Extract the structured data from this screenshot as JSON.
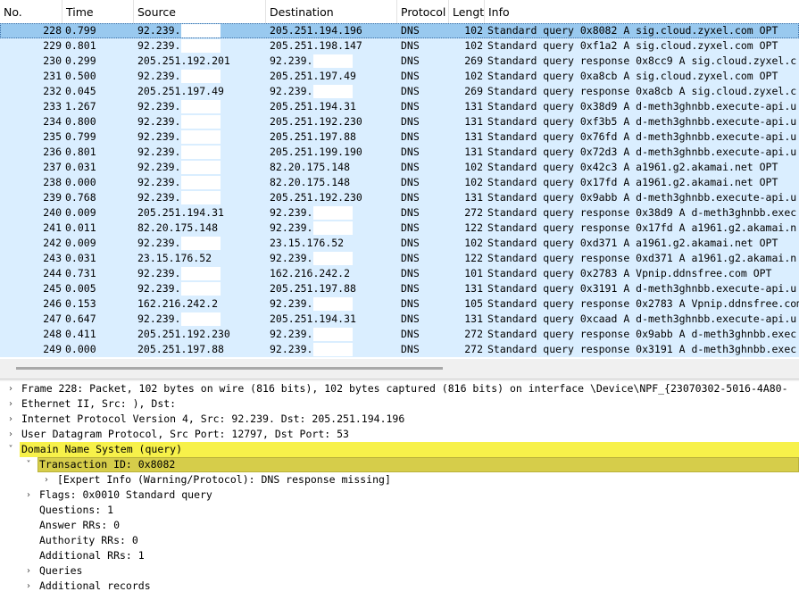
{
  "columns": [
    "No.",
    "Time",
    "Source",
    "Destination",
    "Protocol",
    "Length",
    "Info"
  ],
  "packets": [
    {
      "no": "228",
      "time": "0.799",
      "src": "92.239.",
      "dst": "205.251.194.196",
      "proto": "DNS",
      "len": "102",
      "info": "Standard query 0x8082 A sig.cloud.zyxel.com OPT"
    },
    {
      "no": "229",
      "time": "0.801",
      "src": "92.239.",
      "dst": "205.251.198.147",
      "proto": "DNS",
      "len": "102",
      "info": "Standard query 0xf1a2 A sig.cloud.zyxel.com OPT"
    },
    {
      "no": "230",
      "time": "0.299",
      "src": "205.251.192.201",
      "dst": "92.239.",
      "proto": "DNS",
      "len": "269",
      "info": "Standard query response 0x8cc9 A sig.cloud.zyxel.c"
    },
    {
      "no": "231",
      "time": "0.500",
      "src": "92.239.",
      "dst": "205.251.197.49",
      "proto": "DNS",
      "len": "102",
      "info": "Standard query 0xa8cb A sig.cloud.zyxel.com OPT"
    },
    {
      "no": "232",
      "time": "0.045",
      "src": "205.251.197.49",
      "dst": "92.239.",
      "proto": "DNS",
      "len": "269",
      "info": "Standard query response 0xa8cb A sig.cloud.zyxel.c"
    },
    {
      "no": "233",
      "time": "1.267",
      "src": "92.239.",
      "dst": "205.251.194.31",
      "proto": "DNS",
      "len": "131",
      "info": "Standard query 0x38d9 A d-meth3ghnbb.execute-api.u"
    },
    {
      "no": "234",
      "time": "0.800",
      "src": "92.239.",
      "dst": "205.251.192.230",
      "proto": "DNS",
      "len": "131",
      "info": "Standard query 0xf3b5 A d-meth3ghnbb.execute-api.u"
    },
    {
      "no": "235",
      "time": "0.799",
      "src": "92.239.",
      "dst": "205.251.197.88",
      "proto": "DNS",
      "len": "131",
      "info": "Standard query 0x76fd A d-meth3ghnbb.execute-api.u"
    },
    {
      "no": "236",
      "time": "0.801",
      "src": "92.239.",
      "dst": "205.251.199.190",
      "proto": "DNS",
      "len": "131",
      "info": "Standard query 0x72d3 A d-meth3ghnbb.execute-api.u"
    },
    {
      "no": "237",
      "time": "0.031",
      "src": "92.239.",
      "dst": "82.20.175.148",
      "proto": "DNS",
      "len": "102",
      "info": "Standard query 0x42c3 A a1961.g2.akamai.net OPT"
    },
    {
      "no": "238",
      "time": "0.000",
      "src": "92.239.",
      "dst": "82.20.175.148",
      "proto": "DNS",
      "len": "102",
      "info": "Standard query 0x17fd A a1961.g2.akamai.net OPT"
    },
    {
      "no": "239",
      "time": "0.768",
      "src": "92.239.",
      "dst": "205.251.192.230",
      "proto": "DNS",
      "len": "131",
      "info": "Standard query 0x9abb A d-meth3ghnbb.execute-api.u"
    },
    {
      "no": "240",
      "time": "0.009",
      "src": "205.251.194.31",
      "dst": "92.239.",
      "proto": "DNS",
      "len": "272",
      "info": "Standard query response 0x38d9 A d-meth3ghnbb.exec"
    },
    {
      "no": "241",
      "time": "0.011",
      "src": "82.20.175.148",
      "dst": "92.239.",
      "proto": "DNS",
      "len": "122",
      "info": "Standard query response 0x17fd A a1961.g2.akamai.n"
    },
    {
      "no": "242",
      "time": "0.009",
      "src": "92.239.",
      "dst": "23.15.176.52",
      "proto": "DNS",
      "len": "102",
      "info": "Standard query 0xd371 A a1961.g2.akamai.net OPT"
    },
    {
      "no": "243",
      "time": "0.031",
      "src": "23.15.176.52",
      "dst": "92.239.",
      "proto": "DNS",
      "len": "122",
      "info": "Standard query response 0xd371 A a1961.g2.akamai.n"
    },
    {
      "no": "244",
      "time": "0.731",
      "src": "92.239.",
      "dst": "162.216.242.2",
      "proto": "DNS",
      "len": "101",
      "info": "Standard query 0x2783 A Vpnip.ddnsfree.com OPT"
    },
    {
      "no": "245",
      "time": "0.005",
      "src": "92.239.",
      "dst": "205.251.197.88",
      "proto": "DNS",
      "len": "131",
      "info": "Standard query 0x3191 A d-meth3ghnbb.execute-api.u"
    },
    {
      "no": "246",
      "time": "0.153",
      "src": "162.216.242.2",
      "dst": "92.239.",
      "proto": "DNS",
      "len": "105",
      "info": "Standard query response 0x2783 A Vpnip.ddnsfree.com"
    },
    {
      "no": "247",
      "time": "0.647",
      "src": "92.239.",
      "dst": "205.251.194.31",
      "proto": "DNS",
      "len": "131",
      "info": "Standard query 0xcaad A d-meth3ghnbb.execute-api.u"
    },
    {
      "no": "248",
      "time": "0.411",
      "src": "205.251.192.230",
      "dst": "92.239.",
      "proto": "DNS",
      "len": "272",
      "info": "Standard query response 0x9abb A d-meth3ghnbb.exec"
    },
    {
      "no": "249",
      "time": "0.000",
      "src": "205.251.197.88",
      "dst": "92.239.",
      "proto": "DNS",
      "len": "272",
      "info": "Standard query response 0x3191 A d-meth3ghnbb.exec"
    }
  ],
  "details": [
    {
      "text": "Frame 228: Packet, 102 bytes on wire (816 bits), 102 bytes captured (816 bits) on interface \\Device\\NPF_{23070302-5016-4A80-",
      "depth": 0,
      "twisty": "collapsed",
      "hl": ""
    },
    {
      "text": "Ethernet II, Src:                                         ), Dst:",
      "depth": 0,
      "twisty": "collapsed",
      "hl": ""
    },
    {
      "text": "Internet Protocol Version 4, Src: 92.239.         Dst: 205.251.194.196",
      "depth": 0,
      "twisty": "collapsed",
      "hl": ""
    },
    {
      "text": "User Datagram Protocol, Src Port: 12797, Dst Port: 53",
      "depth": 0,
      "twisty": "collapsed",
      "hl": ""
    },
    {
      "text": "Domain Name System (query)",
      "depth": 0,
      "twisty": "expanded",
      "hl": "yellow"
    },
    {
      "text": "Transaction ID: 0x8082",
      "depth": 1,
      "twisty": "expanded",
      "hl": "olive"
    },
    {
      "text": "[Expert Info (Warning/Protocol): DNS response missing]",
      "depth": 2,
      "twisty": "collapsed",
      "hl": ""
    },
    {
      "text": "Flags: 0x0010 Standard query",
      "depth": 1,
      "twisty": "collapsed",
      "hl": ""
    },
    {
      "text": "Questions: 1",
      "depth": 1,
      "twisty": "",
      "hl": ""
    },
    {
      "text": "Answer RRs: 0",
      "depth": 1,
      "twisty": "",
      "hl": ""
    },
    {
      "text": "Authority RRs: 0",
      "depth": 1,
      "twisty": "",
      "hl": ""
    },
    {
      "text": "Additional RRs: 1",
      "depth": 1,
      "twisty": "",
      "hl": ""
    },
    {
      "text": "Queries",
      "depth": 1,
      "twisty": "collapsed",
      "hl": ""
    },
    {
      "text": "Additional records",
      "depth": 1,
      "twisty": "collapsed",
      "hl": ""
    }
  ],
  "selected_packet": "228",
  "icons": {
    "collapsed": "chevron-right-icon",
    "expanded": "chevron-down-icon"
  },
  "colors": {
    "row_bg": "#daeeff",
    "selected_bg": "#99c9ef",
    "detail_highlight": "#f7f14a",
    "detail_selected": "#d6cd4a"
  }
}
